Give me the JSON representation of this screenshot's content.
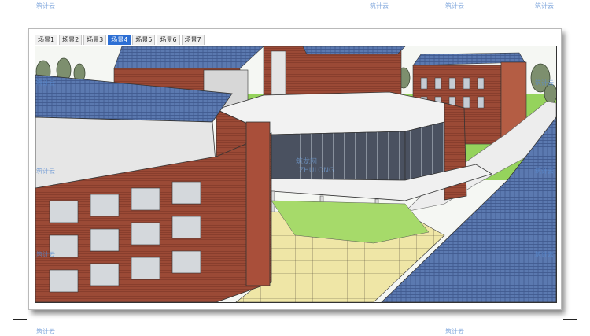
{
  "toolbar": {
    "tabs": [
      {
        "label": "场景1",
        "active": false
      },
      {
        "label": "场景2",
        "active": false
      },
      {
        "label": "场景3",
        "active": false
      },
      {
        "label": "场景4",
        "active": true
      },
      {
        "label": "场景5",
        "active": false
      },
      {
        "label": "场景6",
        "active": false
      },
      {
        "label": "场景7",
        "active": false
      }
    ]
  },
  "watermark": {
    "text": "筑龙网",
    "repeat_text": "筑计云",
    "center_mark": "ZHULONG"
  },
  "colors": {
    "active_tab": "#2d6fd4",
    "brick": "#9b4a36",
    "roof_tile": "#5b79b0",
    "glass": "#4a5160",
    "lawn": "#8fcf5a",
    "paving": "#efe6a6"
  }
}
